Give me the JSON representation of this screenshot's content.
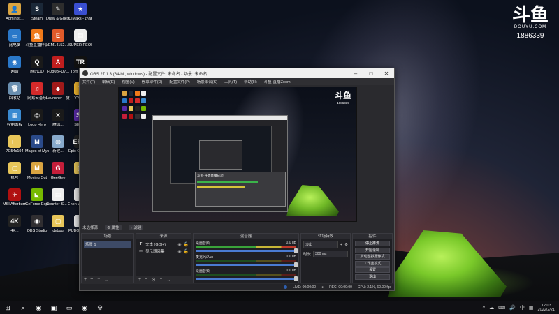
{
  "desktop": {
    "icons": [
      {
        "label": "Administ...",
        "glyph": "👤",
        "color": "#d9a441"
      },
      {
        "label": "Steam",
        "glyph": "S",
        "color": "#1b2838"
      },
      {
        "label": "Draw & Guess",
        "glyph": "✎",
        "color": "#2d2d2d"
      },
      {
        "label": "QiMaxs - 迅捷方式",
        "glyph": "★",
        "color": "#3a4fd1"
      },
      {
        "label": "此电脑",
        "glyph": "▭",
        "color": "#2a78c9"
      },
      {
        "label": "斗鱼直播伴侣",
        "glyph": "鱼",
        "color": "#f07a1a"
      },
      {
        "label": "EM14152...",
        "glyph": "E",
        "color": "#e05a2a"
      },
      {
        "label": "SUPER PEOPLE CBT",
        "glyph": "▤",
        "color": "#eeeeee"
      },
      {
        "label": "网络",
        "glyph": "◉",
        "color": "#2a78c9"
      },
      {
        "label": "腾讯QQ",
        "glyph": "Q",
        "color": "#1a1a1a"
      },
      {
        "label": "FD80BFD7...",
        "glyph": "A",
        "color": "#c01e1e"
      },
      {
        "label": "Tom Raider",
        "glyph": "TR",
        "color": "#111111"
      },
      {
        "label": "回收站",
        "glyph": "🗑",
        "color": "#6a8fb0"
      },
      {
        "label": "网易云音乐",
        "glyph": "♫",
        "color": "#d42a2a"
      },
      {
        "label": "Launcher - 快捷方式",
        "glyph": "◆",
        "color": "#a01a1a"
      },
      {
        "label": "YY语...",
        "glyph": "Y",
        "color": "#f2b830"
      },
      {
        "label": "控制面板",
        "glyph": "▦",
        "color": "#3a8ad1"
      },
      {
        "label": "Loop Hero",
        "glyph": "◎",
        "color": "#1a1a1a"
      },
      {
        "label": "腾讯...",
        "glyph": "✕",
        "color": "#1a1a1a"
      },
      {
        "label": "SE的...",
        "glyph": "SE",
        "color": "#5a2aa8"
      },
      {
        "label": "7C54c194",
        "glyph": "▢",
        "color": "#e8c65a"
      },
      {
        "label": "Mages of Mystralia",
        "glyph": "M",
        "color": "#2a4a8a"
      },
      {
        "label": "新建...",
        "glyph": "◍",
        "color": "#88aacc"
      },
      {
        "label": "Epic Games Launcher",
        "glyph": "EPIC",
        "color": "#222222"
      },
      {
        "label": "账号",
        "glyph": "▢",
        "color": "#e8c65a"
      },
      {
        "label": "Moving Out",
        "glyph": "M",
        "color": "#d9a441"
      },
      {
        "label": "GeeGee",
        "glyph": "G",
        "color": "#c41e3a"
      },
      {
        "label": "bj",
        "glyph": "▢",
        "color": "#e8c65a"
      },
      {
        "label": "MSI Afterburner",
        "glyph": "✈",
        "color": "#b01010"
      },
      {
        "label": "GeForce Experience",
        "glyph": "◣",
        "color": "#76b900"
      },
      {
        "label": "Counter-S... Global Off...",
        "glyph": "▤",
        "color": "#eeeeee"
      },
      {
        "label": "non-whql-...",
        "glyph": "▤",
        "color": "#eeeeee"
      },
      {
        "label": "4K...",
        "glyph": "4K",
        "color": "#222222"
      },
      {
        "label": "OBS Studio",
        "glyph": "◉",
        "color": "#302e31"
      },
      {
        "label": "debug",
        "glyph": "▢",
        "color": "#e8c65a"
      },
      {
        "label": "PUBG BATTLEGR...",
        "glyph": "▤",
        "color": "#eeeeee"
      }
    ]
  },
  "watermark": {
    "mark": "斗鱼",
    "brand": "DOUYU.COM",
    "room_id": "1886339"
  },
  "obs": {
    "title": "OBS 27.1.3 (64-bit, windows) - 配置文件: 未命名 - 场景: 未命名",
    "menu": [
      "文件(F)",
      "编辑(E)",
      "视图(V)",
      "停靠部件(D)",
      "配置文件(P)",
      "场景集合(S)",
      "工具(T)",
      "帮助(H)",
      "斗鱼·直播Zoom"
    ],
    "preview_mark": "斗鱼",
    "preview_room": "1886339",
    "nested_dialog": "斗鱼·开始直播成功",
    "source_bar": {
      "label": "未选择源",
      "props": "属性",
      "filters": "滤镜"
    },
    "docks": {
      "scenes": {
        "title": "场景",
        "items": [
          "场景 1"
        ]
      },
      "sources": {
        "title": "来源",
        "items": [
          {
            "type": "T",
            "name": "文本 (GDI+)"
          },
          {
            "type": "▭",
            "name": "显示器采集"
          }
        ]
      },
      "mixer": {
        "title": "混音器",
        "tracks": [
          {
            "name": "桌面音频",
            "db": "0.0 dB"
          },
          {
            "name": "麦克风/Aux",
            "db": "0.0 dB"
          },
          {
            "name": "桌面音频",
            "db": "0.0 dB"
          }
        ]
      },
      "transitions": {
        "title": "转场特效",
        "type": "淡出",
        "duration_label": "时长",
        "duration": "300 ms"
      },
      "controls": {
        "title": "控件",
        "buttons": [
          "停止推流",
          "开始录制",
          "启动虚拟摄像机",
          "工作室模式",
          "设置",
          "退出"
        ]
      }
    },
    "status": {
      "live": "LIVE: 00:00:00",
      "rec": "REC: 00:00:00",
      "cpu": "CPU: 2.1%, 60.00 fps"
    }
  },
  "taskbar": {
    "items": [
      "⊞",
      "⌕",
      "◉",
      "▣",
      "▭",
      "◉",
      "⚙"
    ],
    "tray": [
      "^",
      "☁",
      "⌨",
      "🔊",
      "中",
      "▦"
    ],
    "time": "12:03",
    "date": "2022/2/21"
  }
}
